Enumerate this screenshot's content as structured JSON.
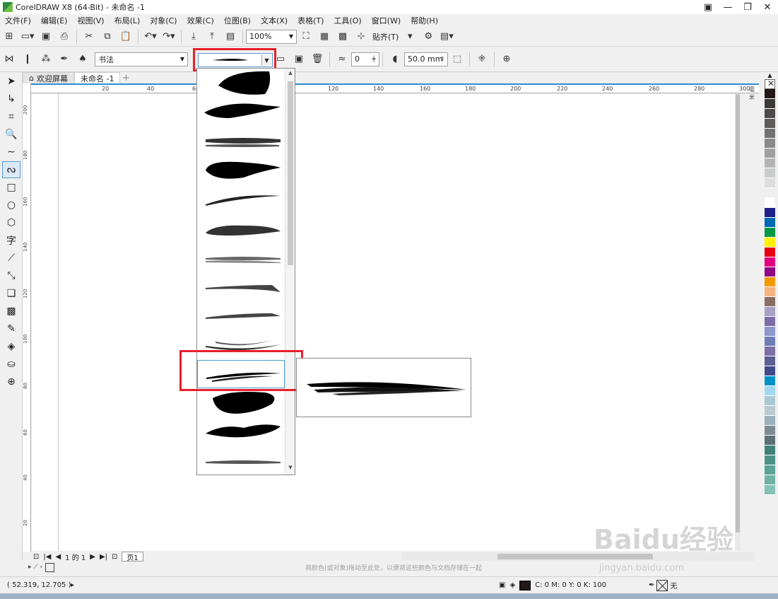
{
  "window": {
    "title": "CorelDRAW X8 (64-Bit) - 未命名 -1"
  },
  "menu": [
    "文件(F)",
    "编辑(E)",
    "视图(V)",
    "布局(L)",
    "对象(C)",
    "效果(C)",
    "位图(B)",
    "文本(X)",
    "表格(T)",
    "工具(O)",
    "窗口(W)",
    "帮助(H)"
  ],
  "toolbar1": {
    "zoom": "100%",
    "snap_label": "贴齐(T)"
  },
  "toolbar2": {
    "preset_category": "书法",
    "smoothing_value": "0",
    "stroke_width": "50.0 mm"
  },
  "tabs": {
    "welcome": "欢迎屏幕",
    "document": "未命名 -1"
  },
  "ruler_h": [
    "20",
    "40",
    "60",
    "120",
    "140",
    "160",
    "180",
    "200",
    "220",
    "240",
    "260",
    "280",
    "300",
    "毫米"
  ],
  "ruler_v": [
    "200",
    "180",
    "160",
    "140",
    "120",
    "100",
    "80",
    "60",
    "40",
    "20"
  ],
  "page_nav": {
    "position": "1 的 1",
    "page_tab": "页1"
  },
  "palette_hint": "将颜色(或对象)拖动至此处，以便将这些颜色与文档存储在一起",
  "status": {
    "coords": "( 52.319, 12.705 )",
    "fill_info": "C: 0 M: 0 Y: 0 K: 100",
    "outline_info": "无"
  },
  "palette_colors": [
    "#231815",
    "#3d3a39",
    "#4d4a49",
    "#5f5c5b",
    "#727171",
    "#898989",
    "#9fa0a0",
    "#b5b5b6",
    "#c9caca",
    "#dcdddd",
    "#efefef",
    "#ffffff",
    "#1d2088",
    "#0068b7",
    "#009944",
    "#fff100",
    "#e60012",
    "#e4007f",
    "#920783",
    "#f39800",
    "#f6b37f",
    "#8b6d64",
    "#a8a1c6",
    "#7e6ca8",
    "#8c97cb",
    "#6f7db8",
    "#7d6fa8",
    "#5b5f93",
    "#3e4a8a",
    "#0092c7",
    "#a0d8ef",
    "#aac8d6",
    "#b8c9d2",
    "#9bb0bb",
    "#7d8b92",
    "#5c7078",
    "#3e8277",
    "#4d9287",
    "#5ca397",
    "#6fb3a6",
    "#84c2b5"
  ],
  "watermark": {
    "main": "Baidu经验",
    "sub": "jingyan.baidu.com"
  }
}
